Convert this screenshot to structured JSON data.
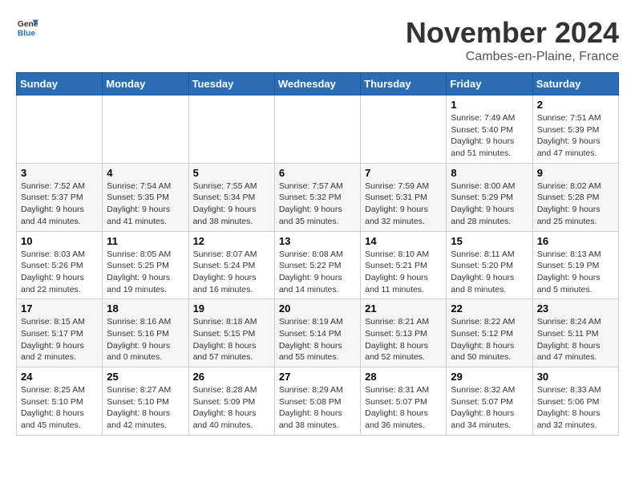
{
  "logo": {
    "line1": "General",
    "line2": "Blue"
  },
  "title": "November 2024",
  "subtitle": "Cambes-en-Plaine, France",
  "headers": [
    "Sunday",
    "Monday",
    "Tuesday",
    "Wednesday",
    "Thursday",
    "Friday",
    "Saturday"
  ],
  "rows": [
    [
      {
        "day": "",
        "info": ""
      },
      {
        "day": "",
        "info": ""
      },
      {
        "day": "",
        "info": ""
      },
      {
        "day": "",
        "info": ""
      },
      {
        "day": "",
        "info": ""
      },
      {
        "day": "1",
        "info": "Sunrise: 7:49 AM\nSunset: 5:40 PM\nDaylight: 9 hours and 51 minutes."
      },
      {
        "day": "2",
        "info": "Sunrise: 7:51 AM\nSunset: 5:39 PM\nDaylight: 9 hours and 47 minutes."
      }
    ],
    [
      {
        "day": "3",
        "info": "Sunrise: 7:52 AM\nSunset: 5:37 PM\nDaylight: 9 hours and 44 minutes."
      },
      {
        "day": "4",
        "info": "Sunrise: 7:54 AM\nSunset: 5:35 PM\nDaylight: 9 hours and 41 minutes."
      },
      {
        "day": "5",
        "info": "Sunrise: 7:55 AM\nSunset: 5:34 PM\nDaylight: 9 hours and 38 minutes."
      },
      {
        "day": "6",
        "info": "Sunrise: 7:57 AM\nSunset: 5:32 PM\nDaylight: 9 hours and 35 minutes."
      },
      {
        "day": "7",
        "info": "Sunrise: 7:59 AM\nSunset: 5:31 PM\nDaylight: 9 hours and 32 minutes."
      },
      {
        "day": "8",
        "info": "Sunrise: 8:00 AM\nSunset: 5:29 PM\nDaylight: 9 hours and 28 minutes."
      },
      {
        "day": "9",
        "info": "Sunrise: 8:02 AM\nSunset: 5:28 PM\nDaylight: 9 hours and 25 minutes."
      }
    ],
    [
      {
        "day": "10",
        "info": "Sunrise: 8:03 AM\nSunset: 5:26 PM\nDaylight: 9 hours and 22 minutes."
      },
      {
        "day": "11",
        "info": "Sunrise: 8:05 AM\nSunset: 5:25 PM\nDaylight: 9 hours and 19 minutes."
      },
      {
        "day": "12",
        "info": "Sunrise: 8:07 AM\nSunset: 5:24 PM\nDaylight: 9 hours and 16 minutes."
      },
      {
        "day": "13",
        "info": "Sunrise: 8:08 AM\nSunset: 5:22 PM\nDaylight: 9 hours and 14 minutes."
      },
      {
        "day": "14",
        "info": "Sunrise: 8:10 AM\nSunset: 5:21 PM\nDaylight: 9 hours and 11 minutes."
      },
      {
        "day": "15",
        "info": "Sunrise: 8:11 AM\nSunset: 5:20 PM\nDaylight: 9 hours and 8 minutes."
      },
      {
        "day": "16",
        "info": "Sunrise: 8:13 AM\nSunset: 5:19 PM\nDaylight: 9 hours and 5 minutes."
      }
    ],
    [
      {
        "day": "17",
        "info": "Sunrise: 8:15 AM\nSunset: 5:17 PM\nDaylight: 9 hours and 2 minutes."
      },
      {
        "day": "18",
        "info": "Sunrise: 8:16 AM\nSunset: 5:16 PM\nDaylight: 9 hours and 0 minutes."
      },
      {
        "day": "19",
        "info": "Sunrise: 8:18 AM\nSunset: 5:15 PM\nDaylight: 8 hours and 57 minutes."
      },
      {
        "day": "20",
        "info": "Sunrise: 8:19 AM\nSunset: 5:14 PM\nDaylight: 8 hours and 55 minutes."
      },
      {
        "day": "21",
        "info": "Sunrise: 8:21 AM\nSunset: 5:13 PM\nDaylight: 8 hours and 52 minutes."
      },
      {
        "day": "22",
        "info": "Sunrise: 8:22 AM\nSunset: 5:12 PM\nDaylight: 8 hours and 50 minutes."
      },
      {
        "day": "23",
        "info": "Sunrise: 8:24 AM\nSunset: 5:11 PM\nDaylight: 8 hours and 47 minutes."
      }
    ],
    [
      {
        "day": "24",
        "info": "Sunrise: 8:25 AM\nSunset: 5:10 PM\nDaylight: 8 hours and 45 minutes."
      },
      {
        "day": "25",
        "info": "Sunrise: 8:27 AM\nSunset: 5:10 PM\nDaylight: 8 hours and 42 minutes."
      },
      {
        "day": "26",
        "info": "Sunrise: 8:28 AM\nSunset: 5:09 PM\nDaylight: 8 hours and 40 minutes."
      },
      {
        "day": "27",
        "info": "Sunrise: 8:29 AM\nSunset: 5:08 PM\nDaylight: 8 hours and 38 minutes."
      },
      {
        "day": "28",
        "info": "Sunrise: 8:31 AM\nSunset: 5:07 PM\nDaylight: 8 hours and 36 minutes."
      },
      {
        "day": "29",
        "info": "Sunrise: 8:32 AM\nSunset: 5:07 PM\nDaylight: 8 hours and 34 minutes."
      },
      {
        "day": "30",
        "info": "Sunrise: 8:33 AM\nSunset: 5:06 PM\nDaylight: 8 hours and 32 minutes."
      }
    ]
  ]
}
